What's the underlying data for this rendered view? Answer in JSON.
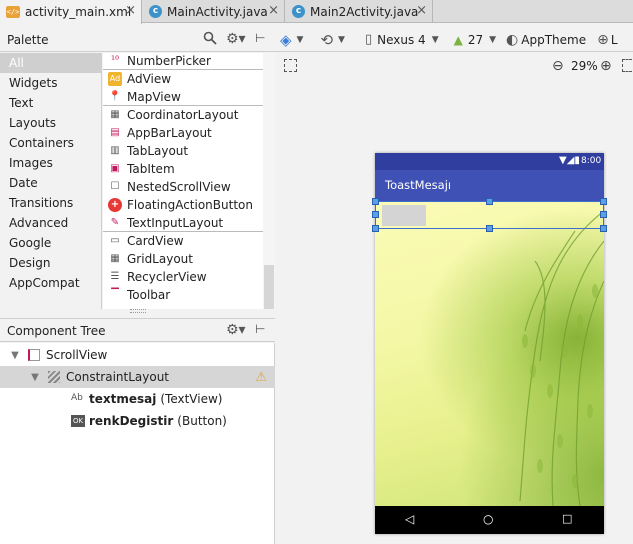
{
  "tabs": [
    {
      "label": "activity_main.xml",
      "icon": "xml-file-icon",
      "active": true
    },
    {
      "label": "MainActivity.java",
      "icon": "java-class-icon",
      "active": false
    },
    {
      "label": "Main2Activity.java",
      "icon": "java-class-icon",
      "active": false
    }
  ],
  "palette": {
    "title": "Palette",
    "categories": [
      "All",
      "Widgets",
      "Text",
      "Layouts",
      "Containers",
      "Images",
      "Date",
      "Transitions",
      "Advanced",
      "Google",
      "Design",
      "AppCompat"
    ],
    "selected_category": "All",
    "items": [
      "NumberPicker",
      "AdView",
      "MapView",
      "CoordinatorLayout",
      "AppBarLayout",
      "TabLayout",
      "TabItem",
      "NestedScrollView",
      "FloatingActionButton",
      "TextInputLayout",
      "CardView",
      "GridLayout",
      "RecyclerView",
      "Toolbar"
    ]
  },
  "component_tree": {
    "title": "Component Tree",
    "nodes": [
      {
        "name": "ScrollView",
        "type": ""
      },
      {
        "name": "ConstraintLayout",
        "type": ""
      },
      {
        "name": "textmesaj",
        "type": "(TextView)"
      },
      {
        "name": "renkDegistir",
        "type": "(Button)"
      }
    ]
  },
  "toolbar": {
    "device": "Nexus 4",
    "api": "27",
    "theme": "AppTheme",
    "zoom": "29%"
  },
  "device_preview": {
    "time": "8:00",
    "app_title": "ToastMesajı"
  },
  "colors": {
    "primary": "#3f51b5",
    "primary_dark": "#303f9f",
    "selection": "#3d6fd0",
    "warning": "#e8a33a"
  }
}
